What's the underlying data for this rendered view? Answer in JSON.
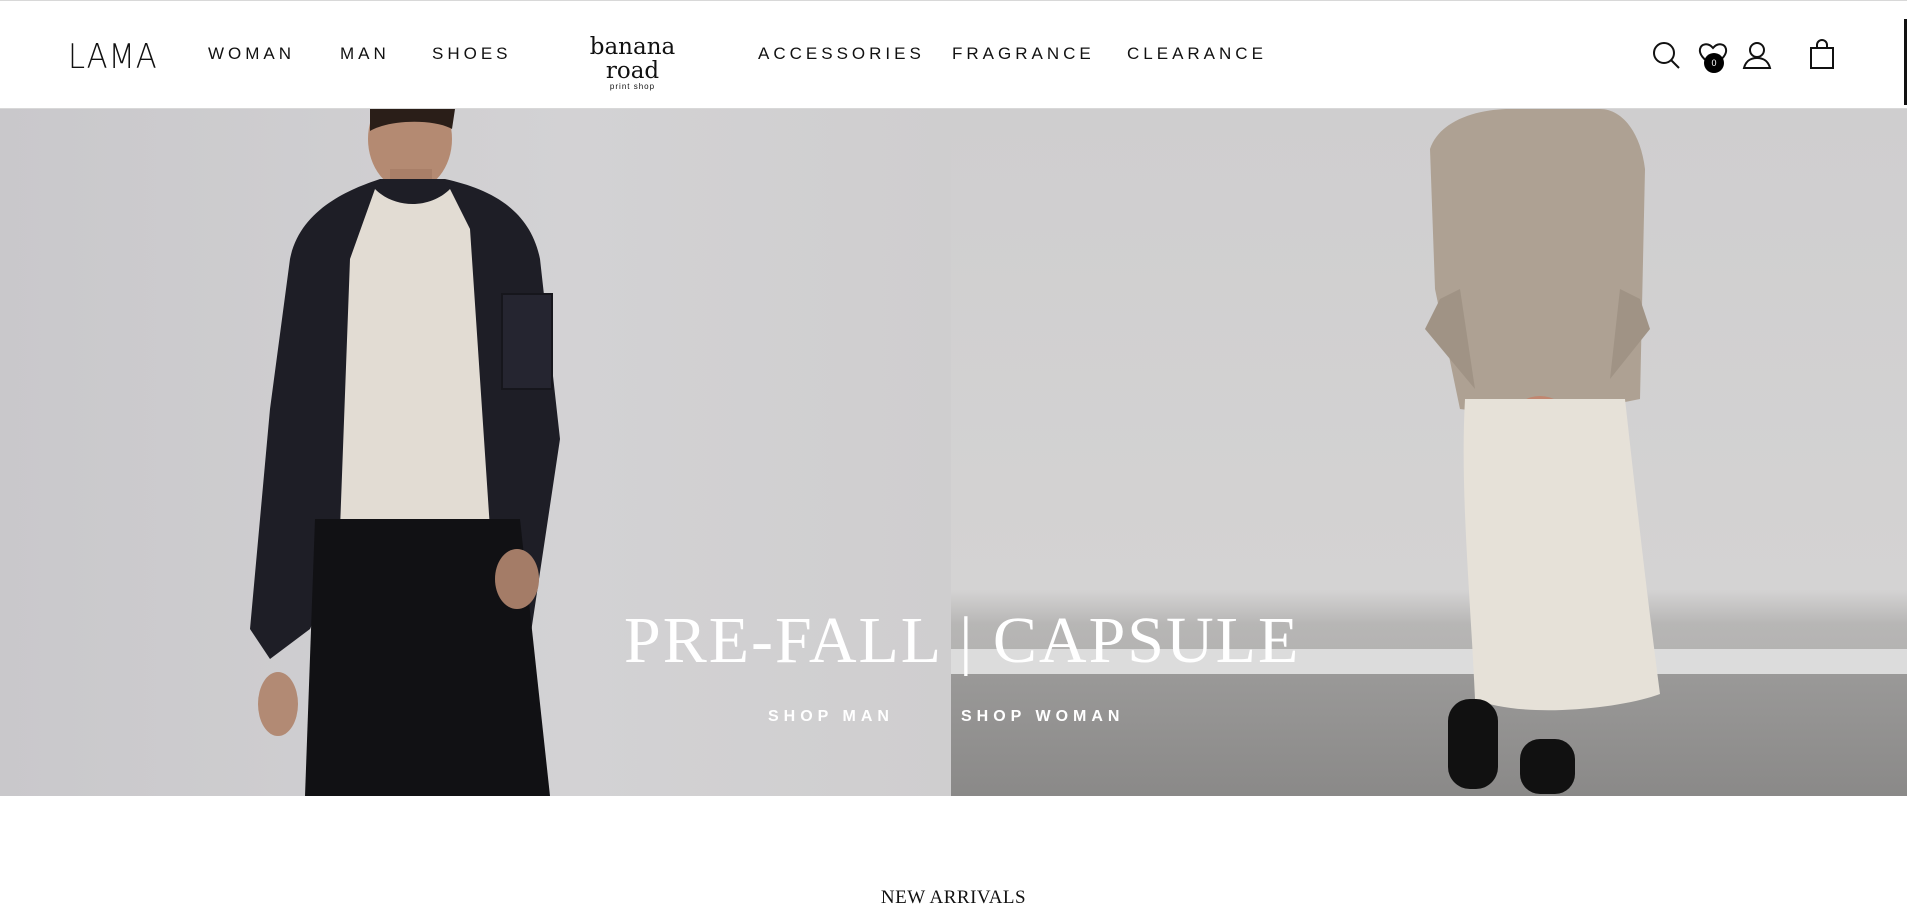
{
  "header": {
    "logo": "LAMA",
    "nav_left": [
      {
        "label": "WOMAN"
      },
      {
        "label": "MAN"
      },
      {
        "label": "SHOES"
      }
    ],
    "brand": {
      "name": "banana road",
      "sub": "print shop"
    },
    "nav_right": [
      {
        "label": "ACCESSORIES"
      },
      {
        "label": "FRAGRANCE"
      },
      {
        "label": "CLEARANCE"
      }
    ],
    "icons": [
      "search-icon",
      "wishlist-icon",
      "account-icon",
      "cart-icon"
    ],
    "wishlist_count": "0"
  },
  "hero": {
    "title_left": "PRE-FALL",
    "title_separator": "|",
    "title_right": "CAPSULE",
    "shop_man": "SHOP MAN",
    "shop_woman": "SHOP WOMAN"
  },
  "sections": {
    "new_arrivals": "NEW ARRIVALS"
  },
  "colors": {
    "background": "#ffffff",
    "text": "#111111",
    "hero_text": "#ffffff",
    "badge": "#000000"
  }
}
